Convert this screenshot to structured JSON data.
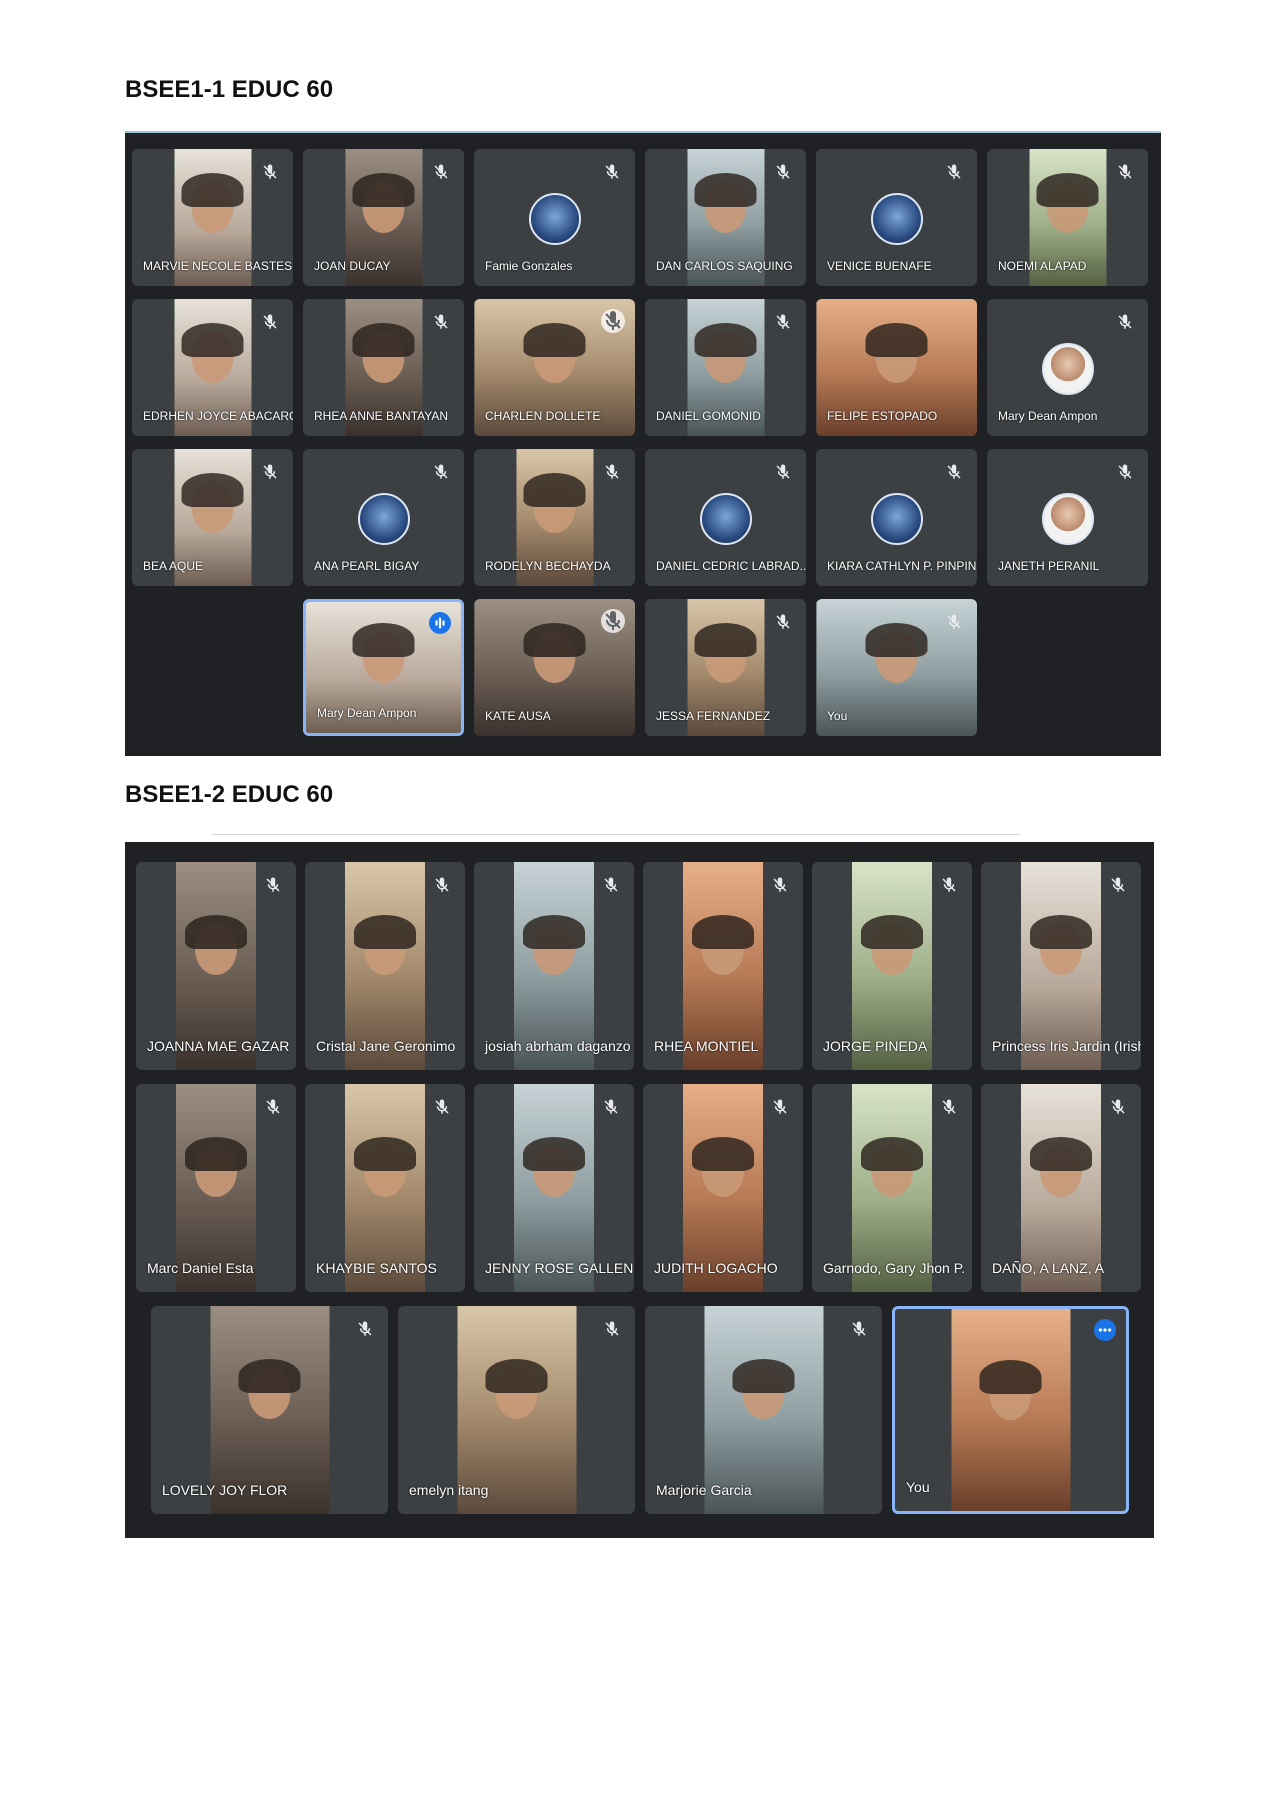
{
  "sections": [
    {
      "title": "BSEE1-1 EDUC 60",
      "participants": [
        {
          "name": "MARVIE NECOLE BASTES",
          "tile": "video",
          "status": "muted"
        },
        {
          "name": "JOAN DUCAY",
          "tile": "video",
          "status": "muted"
        },
        {
          "name": "Famie Gonzales",
          "tile": "avatar",
          "status": "muted"
        },
        {
          "name": "DAN CARLOS SAQUING",
          "tile": "video",
          "status": "muted"
        },
        {
          "name": "VENICE BUENAFE",
          "tile": "avatar",
          "status": "muted"
        },
        {
          "name": "NOEMI ALAPAD",
          "tile": "video",
          "status": "muted"
        },
        {
          "name": "EDRHEN JOYCE ABACARO",
          "tile": "video",
          "status": "muted"
        },
        {
          "name": "RHEA ANNE BANTAYAN",
          "tile": "video",
          "status": "muted"
        },
        {
          "name": "CHARLEN DOLLETE",
          "tile": "video",
          "status": "muted"
        },
        {
          "name": "DANIEL GOMONID",
          "tile": "video",
          "status": "muted"
        },
        {
          "name": "FELIPE ESTOPADO",
          "tile": "video",
          "status": "none"
        },
        {
          "name": "Mary Dean Ampon",
          "tile": "avatar",
          "status": "muted"
        },
        {
          "name": "BEA AQUE",
          "tile": "video",
          "status": "muted"
        },
        {
          "name": "ANA PEARL BIGAY",
          "tile": "avatar",
          "status": "muted"
        },
        {
          "name": "RODELYN BECHAYDA",
          "tile": "video",
          "status": "muted"
        },
        {
          "name": "DANIEL CEDRIC LABRAD...",
          "tile": "avatar",
          "status": "muted"
        },
        {
          "name": "KIARA CATHLYN P. PINPIN",
          "tile": "avatar",
          "status": "muted"
        },
        {
          "name": "JANETH PERANIL",
          "tile": "avatar",
          "status": "muted"
        },
        {
          "name": "Mary Dean Ampon",
          "tile": "video",
          "status": "speaking"
        },
        {
          "name": "KATE AUSA",
          "tile": "video",
          "status": "muted"
        },
        {
          "name": "JESSA FERNANDEZ",
          "tile": "video",
          "status": "muted"
        },
        {
          "name": "You",
          "tile": "video",
          "status": "muted"
        }
      ]
    },
    {
      "title": "BSEE1-2 EDUC 60",
      "participants": [
        {
          "name": "JOANNA MAE GAZAR",
          "tile": "video",
          "status": "muted"
        },
        {
          "name": "Cristal Jane Geronimo",
          "tile": "video",
          "status": "muted"
        },
        {
          "name": "josiah abrham daganzo",
          "tile": "video",
          "status": "muted"
        },
        {
          "name": "RHEA MONTIEL",
          "tile": "video",
          "status": "muted"
        },
        {
          "name": "JORGE PINEDA",
          "tile": "video",
          "status": "muted"
        },
        {
          "name": "Princess Iris Jardin (Irish)",
          "tile": "video",
          "status": "muted"
        },
        {
          "name": "Marc Daniel Esta",
          "tile": "video",
          "status": "muted"
        },
        {
          "name": "KHAYBIE SANTOS",
          "tile": "video",
          "status": "muted"
        },
        {
          "name": "JENNY ROSE GALLENTES",
          "tile": "video",
          "status": "muted"
        },
        {
          "name": "JUDITH LOGACHO",
          "tile": "video",
          "status": "muted"
        },
        {
          "name": "Garnodo, Gary Jhon P.",
          "tile": "video",
          "status": "muted"
        },
        {
          "name": "DAÑO, A LANZ, A",
          "tile": "video",
          "status": "muted"
        },
        {
          "name": "LOVELY JOY FLOR",
          "tile": "video",
          "status": "muted"
        },
        {
          "name": "emelyn itang",
          "tile": "video",
          "status": "muted"
        },
        {
          "name": "Marjorie Garcia",
          "tile": "video",
          "status": "muted"
        },
        {
          "name": "You",
          "tile": "video",
          "status": "more-options"
        }
      ]
    }
  ],
  "icons": {
    "muted": "mic-off-icon",
    "speaking": "audio-level-icon",
    "more-options": "more-options-icon"
  },
  "colors": {
    "background": "#202124",
    "tile": "#3c4043",
    "active_border": "#8ab4f8",
    "accent": "#1a73e8"
  }
}
